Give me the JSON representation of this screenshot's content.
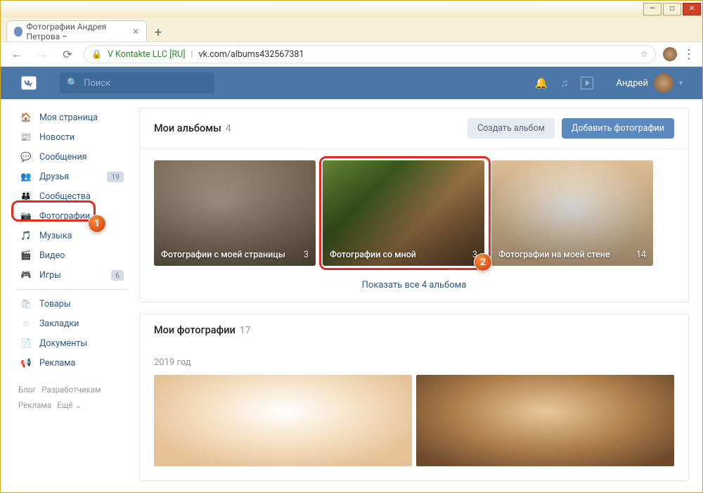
{
  "browser": {
    "tab_title": "Фотографии Андрея Петрова –",
    "new_tab": "+",
    "org": "V Kontakte LLC [RU]",
    "url": "vk.com/albums432567381"
  },
  "header": {
    "search_placeholder": "Поиск",
    "user_name": "Андрей"
  },
  "sidebar": {
    "items": [
      {
        "label": "Моя страница"
      },
      {
        "label": "Новости"
      },
      {
        "label": "Сообщения"
      },
      {
        "label": "Друзья",
        "badge": "19"
      },
      {
        "label": "Сообщества"
      },
      {
        "label": "Фотографии"
      },
      {
        "label": "Музыка"
      },
      {
        "label": "Видео"
      },
      {
        "label": "Игры",
        "badge": "6"
      }
    ],
    "items2": [
      {
        "label": "Товары"
      },
      {
        "label": "Закладки"
      },
      {
        "label": "Документы"
      },
      {
        "label": "Реклама"
      }
    ],
    "footer": {
      "blog": "Блог",
      "dev": "Разработчикам",
      "ad": "Реклама",
      "more": "Ещё ⌄"
    }
  },
  "albums_section": {
    "title": "Мои альбомы",
    "count": "4",
    "create": "Создать альбом",
    "add": "Добавить фотографии",
    "albums": [
      {
        "title": "Фотографии с моей страницы",
        "count": "3"
      },
      {
        "title": "Фотографии со мной",
        "count": "3"
      },
      {
        "title": "Фотографии на моей стене",
        "count": "14"
      }
    ],
    "show_all": "Показать все 4 альбома"
  },
  "photos_section": {
    "title": "Мои фотографии",
    "count": "17",
    "year": "2019 год"
  },
  "annot": {
    "b1": "1",
    "b2": "2"
  }
}
